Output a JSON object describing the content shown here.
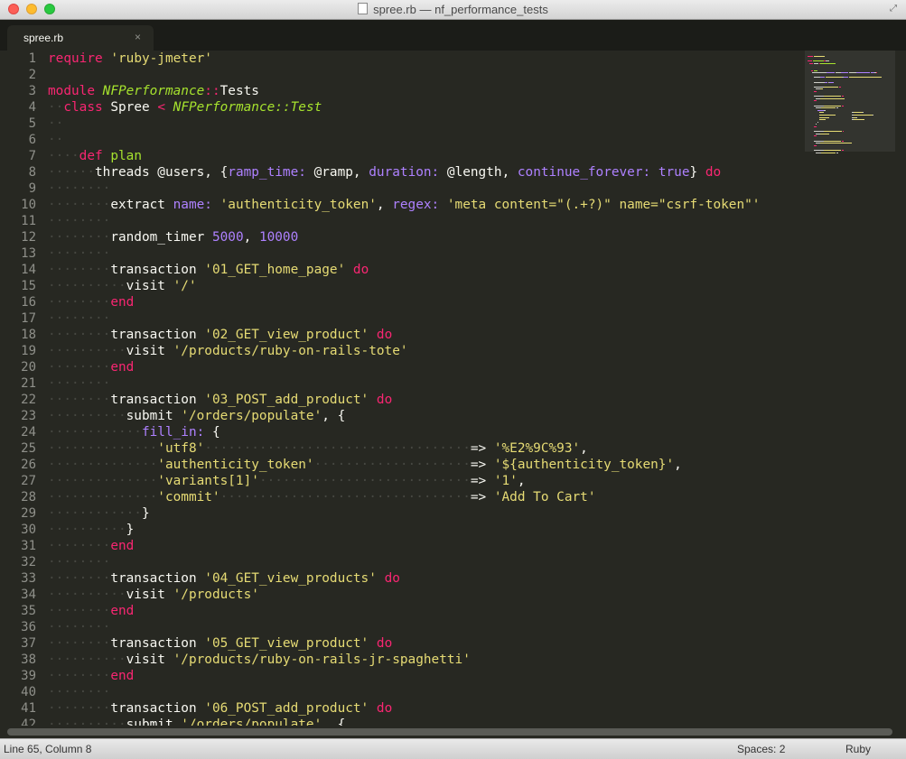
{
  "window": {
    "title": "spree.rb — nf_performance_tests"
  },
  "tab": {
    "label": "spree.rb",
    "close_glyph": "×"
  },
  "status": {
    "position": "Line 65, Column 8",
    "indentation": "Spaces: 2",
    "syntax": "Ruby"
  },
  "colors": {
    "background": "#272822",
    "foreground": "#f8f8f2",
    "keyword": "#f92672",
    "string": "#e6db74",
    "class": "#a6e22e",
    "number": "#ae81ff",
    "symbol": "#ae81ff",
    "line_number": "#8f908a",
    "indent_guide": "#464741"
  },
  "editor": {
    "lines": [
      {
        "n": "1",
        "t": [
          [
            "k",
            "require"
          ],
          [
            "p",
            " "
          ],
          [
            "s",
            "'ruby-jmeter'"
          ]
        ]
      },
      {
        "n": "2",
        "t": []
      },
      {
        "n": "3",
        "t": [
          [
            "k",
            "module"
          ],
          [
            "p",
            " "
          ],
          [
            "ci",
            "NFPerformance"
          ],
          [
            "k",
            "::"
          ],
          [
            "pl",
            "Tests"
          ]
        ]
      },
      {
        "n": "4",
        "t": [
          [
            "ind",
            "··"
          ],
          [
            "k",
            "class"
          ],
          [
            "p",
            " "
          ],
          [
            "pl",
            "Spree"
          ],
          [
            "p",
            " "
          ],
          [
            "k",
            "<"
          ],
          [
            "p",
            " "
          ],
          [
            "ci",
            "NFPerformance::Test"
          ]
        ]
      },
      {
        "n": "5",
        "t": [
          [
            "ind",
            "··"
          ]
        ]
      },
      {
        "n": "6",
        "t": [
          [
            "ind",
            "··"
          ]
        ]
      },
      {
        "n": "7",
        "t": [
          [
            "ind",
            "····"
          ],
          [
            "k",
            "def"
          ],
          [
            "p",
            " "
          ],
          [
            "c",
            "plan"
          ]
        ]
      },
      {
        "n": "8",
        "t": [
          [
            "ind",
            "······"
          ],
          [
            "pl",
            "threads "
          ],
          [
            "iv",
            "@users"
          ],
          [
            "p",
            ", {"
          ],
          [
            "sym",
            "ramp_time:"
          ],
          [
            "p",
            " "
          ],
          [
            "iv",
            "@ramp"
          ],
          [
            "p",
            ", "
          ],
          [
            "sym",
            "duration:"
          ],
          [
            "p",
            " "
          ],
          [
            "iv",
            "@length"
          ],
          [
            "p",
            ", "
          ],
          [
            "sym",
            "continue_forever:"
          ],
          [
            "p",
            " "
          ],
          [
            "n",
            "true"
          ],
          [
            "p",
            "} "
          ],
          [
            "k",
            "do"
          ]
        ]
      },
      {
        "n": "9",
        "t": [
          [
            "ind",
            "········"
          ]
        ]
      },
      {
        "n": "10",
        "t": [
          [
            "ind",
            "········"
          ],
          [
            "pl",
            "extract "
          ],
          [
            "sym",
            "name:"
          ],
          [
            "p",
            " "
          ],
          [
            "s",
            "'authenticity_token'"
          ],
          [
            "p",
            ", "
          ],
          [
            "sym",
            "regex:"
          ],
          [
            "p",
            " "
          ],
          [
            "s",
            "'meta content=\"(.+?)\" name=\"csrf-token\"'"
          ]
        ]
      },
      {
        "n": "11",
        "t": [
          [
            "ind",
            "········"
          ]
        ]
      },
      {
        "n": "12",
        "t": [
          [
            "ind",
            "········"
          ],
          [
            "pl",
            "random_timer "
          ],
          [
            "n",
            "5000"
          ],
          [
            "p",
            ", "
          ],
          [
            "n",
            "10000"
          ]
        ]
      },
      {
        "n": "13",
        "t": [
          [
            "ind",
            "········"
          ]
        ]
      },
      {
        "n": "14",
        "t": [
          [
            "ind",
            "········"
          ],
          [
            "pl",
            "transaction "
          ],
          [
            "s",
            "'01_GET_home_page'"
          ],
          [
            "p",
            " "
          ],
          [
            "k",
            "do"
          ]
        ]
      },
      {
        "n": "15",
        "t": [
          [
            "ind",
            "··········"
          ],
          [
            "pl",
            "visit "
          ],
          [
            "s",
            "'/'"
          ]
        ]
      },
      {
        "n": "16",
        "t": [
          [
            "ind",
            "········"
          ],
          [
            "k",
            "end"
          ]
        ]
      },
      {
        "n": "17",
        "t": [
          [
            "ind",
            "········"
          ]
        ]
      },
      {
        "n": "18",
        "t": [
          [
            "ind",
            "········"
          ],
          [
            "pl",
            "transaction "
          ],
          [
            "s",
            "'02_GET_view_product'"
          ],
          [
            "p",
            " "
          ],
          [
            "k",
            "do"
          ]
        ]
      },
      {
        "n": "19",
        "t": [
          [
            "ind",
            "··········"
          ],
          [
            "pl",
            "visit "
          ],
          [
            "s",
            "'/products/ruby-on-rails-tote'"
          ]
        ]
      },
      {
        "n": "20",
        "t": [
          [
            "ind",
            "········"
          ],
          [
            "k",
            "end"
          ]
        ]
      },
      {
        "n": "21",
        "t": [
          [
            "ind",
            "········"
          ]
        ]
      },
      {
        "n": "22",
        "t": [
          [
            "ind",
            "········"
          ],
          [
            "pl",
            "transaction "
          ],
          [
            "s",
            "'03_POST_add_product'"
          ],
          [
            "p",
            " "
          ],
          [
            "k",
            "do"
          ]
        ]
      },
      {
        "n": "23",
        "t": [
          [
            "ind",
            "··········"
          ],
          [
            "pl",
            "submit "
          ],
          [
            "s",
            "'/orders/populate'"
          ],
          [
            "p",
            ", {"
          ]
        ]
      },
      {
        "n": "24",
        "t": [
          [
            "ind",
            "············"
          ],
          [
            "sym",
            "fill_in:"
          ],
          [
            "p",
            " {"
          ]
        ]
      },
      {
        "n": "25",
        "t": [
          [
            "ind",
            "··············"
          ],
          [
            "s",
            "'utf8'"
          ],
          [
            "ind",
            "··································"
          ],
          [
            "p",
            "=> "
          ],
          [
            "s",
            "'%E2%9C%93'"
          ],
          [
            "p",
            ","
          ]
        ]
      },
      {
        "n": "26",
        "t": [
          [
            "ind",
            "··············"
          ],
          [
            "s",
            "'authenticity_token'"
          ],
          [
            "ind",
            "····················"
          ],
          [
            "p",
            "=> "
          ],
          [
            "s",
            "'${authenticity_token}'"
          ],
          [
            "p",
            ","
          ]
        ]
      },
      {
        "n": "27",
        "t": [
          [
            "ind",
            "··············"
          ],
          [
            "s",
            "'variants[1]'"
          ],
          [
            "ind",
            "···························"
          ],
          [
            "p",
            "=> "
          ],
          [
            "s",
            "'1'"
          ],
          [
            "p",
            ","
          ]
        ]
      },
      {
        "n": "28",
        "t": [
          [
            "ind",
            "··············"
          ],
          [
            "s",
            "'commit'"
          ],
          [
            "ind",
            "································"
          ],
          [
            "p",
            "=> "
          ],
          [
            "s",
            "'Add To Cart'"
          ]
        ]
      },
      {
        "n": "29",
        "t": [
          [
            "ind",
            "············"
          ],
          [
            "p",
            "}"
          ]
        ]
      },
      {
        "n": "30",
        "t": [
          [
            "ind",
            "··········"
          ],
          [
            "p",
            "}"
          ]
        ]
      },
      {
        "n": "31",
        "t": [
          [
            "ind",
            "········"
          ],
          [
            "k",
            "end"
          ]
        ]
      },
      {
        "n": "32",
        "t": [
          [
            "ind",
            "········"
          ]
        ]
      },
      {
        "n": "33",
        "t": [
          [
            "ind",
            "········"
          ],
          [
            "pl",
            "transaction "
          ],
          [
            "s",
            "'04_GET_view_products'"
          ],
          [
            "p",
            " "
          ],
          [
            "k",
            "do"
          ]
        ]
      },
      {
        "n": "34",
        "t": [
          [
            "ind",
            "··········"
          ],
          [
            "pl",
            "visit "
          ],
          [
            "s",
            "'/products'"
          ]
        ]
      },
      {
        "n": "35",
        "t": [
          [
            "ind",
            "········"
          ],
          [
            "k",
            "end"
          ]
        ]
      },
      {
        "n": "36",
        "t": [
          [
            "ind",
            "········"
          ]
        ]
      },
      {
        "n": "37",
        "t": [
          [
            "ind",
            "········"
          ],
          [
            "pl",
            "transaction "
          ],
          [
            "s",
            "'05_GET_view_product'"
          ],
          [
            "p",
            " "
          ],
          [
            "k",
            "do"
          ]
        ]
      },
      {
        "n": "38",
        "t": [
          [
            "ind",
            "··········"
          ],
          [
            "pl",
            "visit "
          ],
          [
            "s",
            "'/products/ruby-on-rails-jr-spaghetti'"
          ]
        ]
      },
      {
        "n": "39",
        "t": [
          [
            "ind",
            "········"
          ],
          [
            "k",
            "end"
          ]
        ]
      },
      {
        "n": "40",
        "t": [
          [
            "ind",
            "········"
          ]
        ]
      },
      {
        "n": "41",
        "t": [
          [
            "ind",
            "········"
          ],
          [
            "pl",
            "transaction "
          ],
          [
            "s",
            "'06_POST_add_product'"
          ],
          [
            "p",
            " "
          ],
          [
            "k",
            "do"
          ]
        ]
      },
      {
        "n": "42",
        "t": [
          [
            "ind",
            "··········"
          ],
          [
            "pl",
            "submit "
          ],
          [
            "s",
            "'/orders/populate'"
          ],
          [
            "p",
            ", {"
          ]
        ]
      }
    ]
  }
}
